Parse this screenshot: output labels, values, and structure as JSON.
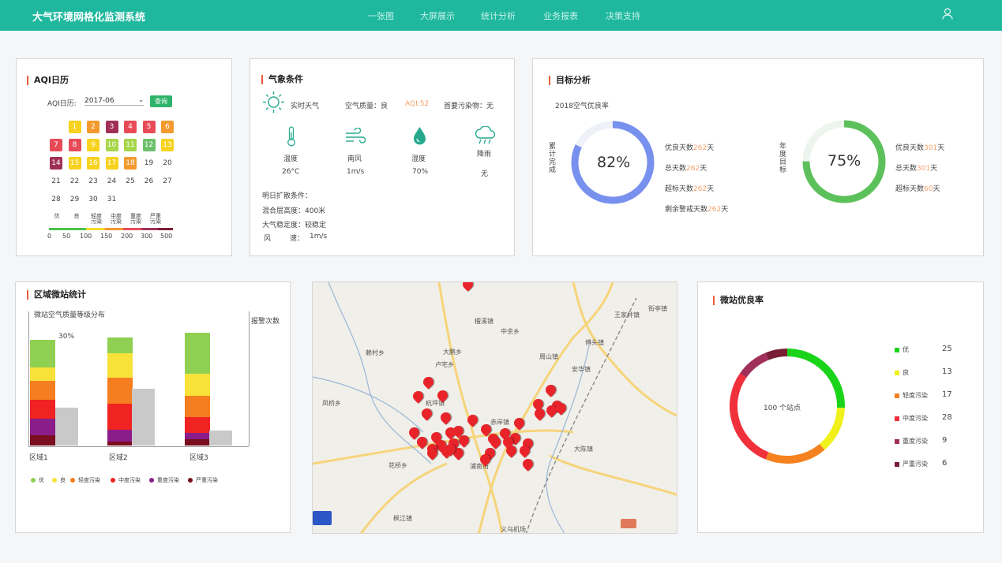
{
  "header": {
    "title": "大气环境网格化监测系统",
    "nav": [
      "一张图",
      "大屏展示",
      "统计分析",
      "业务报表",
      "决策支持"
    ]
  },
  "aqi_calendar": {
    "title": "AQI日历",
    "label": "AQI日历:",
    "month": "2017-06",
    "query_button": "查询",
    "days": [
      [
        "",
        ""
      ],
      [
        "1",
        "#f7d21e"
      ],
      [
        "2",
        "#f39a2e"
      ],
      [
        "3",
        "#a03058"
      ],
      [
        "4",
        "#e84b58"
      ],
      [
        "5",
        "#e84b58"
      ],
      [
        "6",
        "#f39a2e"
      ],
      [
        "7",
        "#e84b58"
      ],
      [
        "8",
        "#e84b58"
      ],
      [
        "9",
        "#f7d21e"
      ],
      [
        "10",
        "#a6d64a"
      ],
      [
        "11",
        "#a6d64a"
      ],
      [
        "12",
        "#6cc06a"
      ],
      [
        "13",
        "#f7d21e"
      ],
      [
        "14",
        "#a03058"
      ],
      [
        "15",
        "#f7d21e"
      ],
      [
        "16",
        "#f7d21e"
      ],
      [
        "17",
        "#f7d21e"
      ],
      [
        "18",
        "#f39a2e"
      ],
      [
        "19",
        ""
      ],
      [
        "20",
        ""
      ],
      [
        "21",
        ""
      ],
      [
        "22",
        ""
      ],
      [
        "23",
        ""
      ],
      [
        "24",
        ""
      ],
      [
        "25",
        ""
      ],
      [
        "26",
        ""
      ],
      [
        "27",
        ""
      ],
      [
        "28",
        ""
      ],
      [
        "29",
        ""
      ],
      [
        "30",
        ""
      ],
      [
        "31",
        ""
      ]
    ],
    "legend_labels": [
      "优",
      "良",
      "轻度污染",
      "中度污染",
      "重度污染",
      "严重污染"
    ],
    "scale": [
      "0",
      "50",
      "100",
      "150",
      "200",
      "300",
      "500"
    ]
  },
  "weather": {
    "title": "气象条件",
    "realtime": "实时天气",
    "air_quality": "空气质量：良",
    "aqi": "AQI:52",
    "primary_pollutant": "首要污染物：无",
    "items": [
      {
        "label": "温度",
        "value": "26°C",
        "icon": "thermometer-icon"
      },
      {
        "label": "南风",
        "value": "1m/s",
        "icon": "wind-icon"
      },
      {
        "label": "湿度",
        "value": "70%",
        "icon": "humidity-icon"
      },
      {
        "label": "降雨",
        "value": "无",
        "icon": "rain-cloud-icon"
      }
    ],
    "tomorrow": "明日扩散条件：",
    "mixing": "混合层高度：400米",
    "stability": "大气稳定度：较稳定",
    "wind_label": "风",
    "wind_label2": "速：",
    "wind_value": "1m/s"
  },
  "target": {
    "title": "目标分析",
    "subtitle": "2018空气优良率",
    "left": {
      "vertical_label": "累计完成",
      "percent": "82%",
      "value": 0.82,
      "lines": [
        [
          "优良天数",
          "262",
          "天"
        ],
        [
          "总天数",
          "262",
          "天"
        ],
        [
          "超标天数",
          "262",
          "天"
        ],
        [
          "剩余警戒天数",
          "262",
          "天"
        ]
      ]
    },
    "right": {
      "vertical_label": "年度目标",
      "percent": "75%",
      "value": 0.75,
      "lines": [
        [
          "优良天数",
          "301",
          "天"
        ],
        [
          "总天数",
          "301",
          "天"
        ],
        [
          "超标天数",
          "60",
          "天"
        ]
      ]
    }
  },
  "region_stats": {
    "title": "区域微站统计",
    "subtitle": "微站空气质量等级分布",
    "right_axis": "报警次数",
    "pct_label": "30%",
    "regions": [
      "区域1",
      "区域2",
      "区域3"
    ],
    "legend": [
      "优",
      "良",
      "轻度污染",
      "中度污染",
      "重度污染",
      "严重污染"
    ]
  },
  "map": {
    "places": [
      "檀溪镇",
      "中余乡",
      "大鹏乡",
      "卢宅乡",
      "赖村乡",
      "周山镇",
      "傅头镇",
      "安华镇",
      "王家井镇",
      "街亭镇",
      "凤桥乡",
      "大陈镇",
      "杭坪镇",
      "花桥乡",
      "枫江镇",
      "义乌机场",
      "赤岸镇",
      "浦南街"
    ]
  },
  "station_rate": {
    "title": "微站优良率",
    "center": "100 个站点",
    "items": [
      {
        "label": "优",
        "value": 25,
        "color": "#1ad41a"
      },
      {
        "label": "良",
        "value": 13,
        "color": "#f0f01a"
      },
      {
        "label": "轻度污染",
        "value": 17,
        "color": "#f5821f"
      },
      {
        "label": "中度污染",
        "value": 28,
        "color": "#f0303a"
      },
      {
        "label": "重度污染",
        "value": 9,
        "color": "#a0305a"
      },
      {
        "label": "严重污染",
        "value": 6,
        "color": "#7a1e35"
      }
    ]
  }
}
